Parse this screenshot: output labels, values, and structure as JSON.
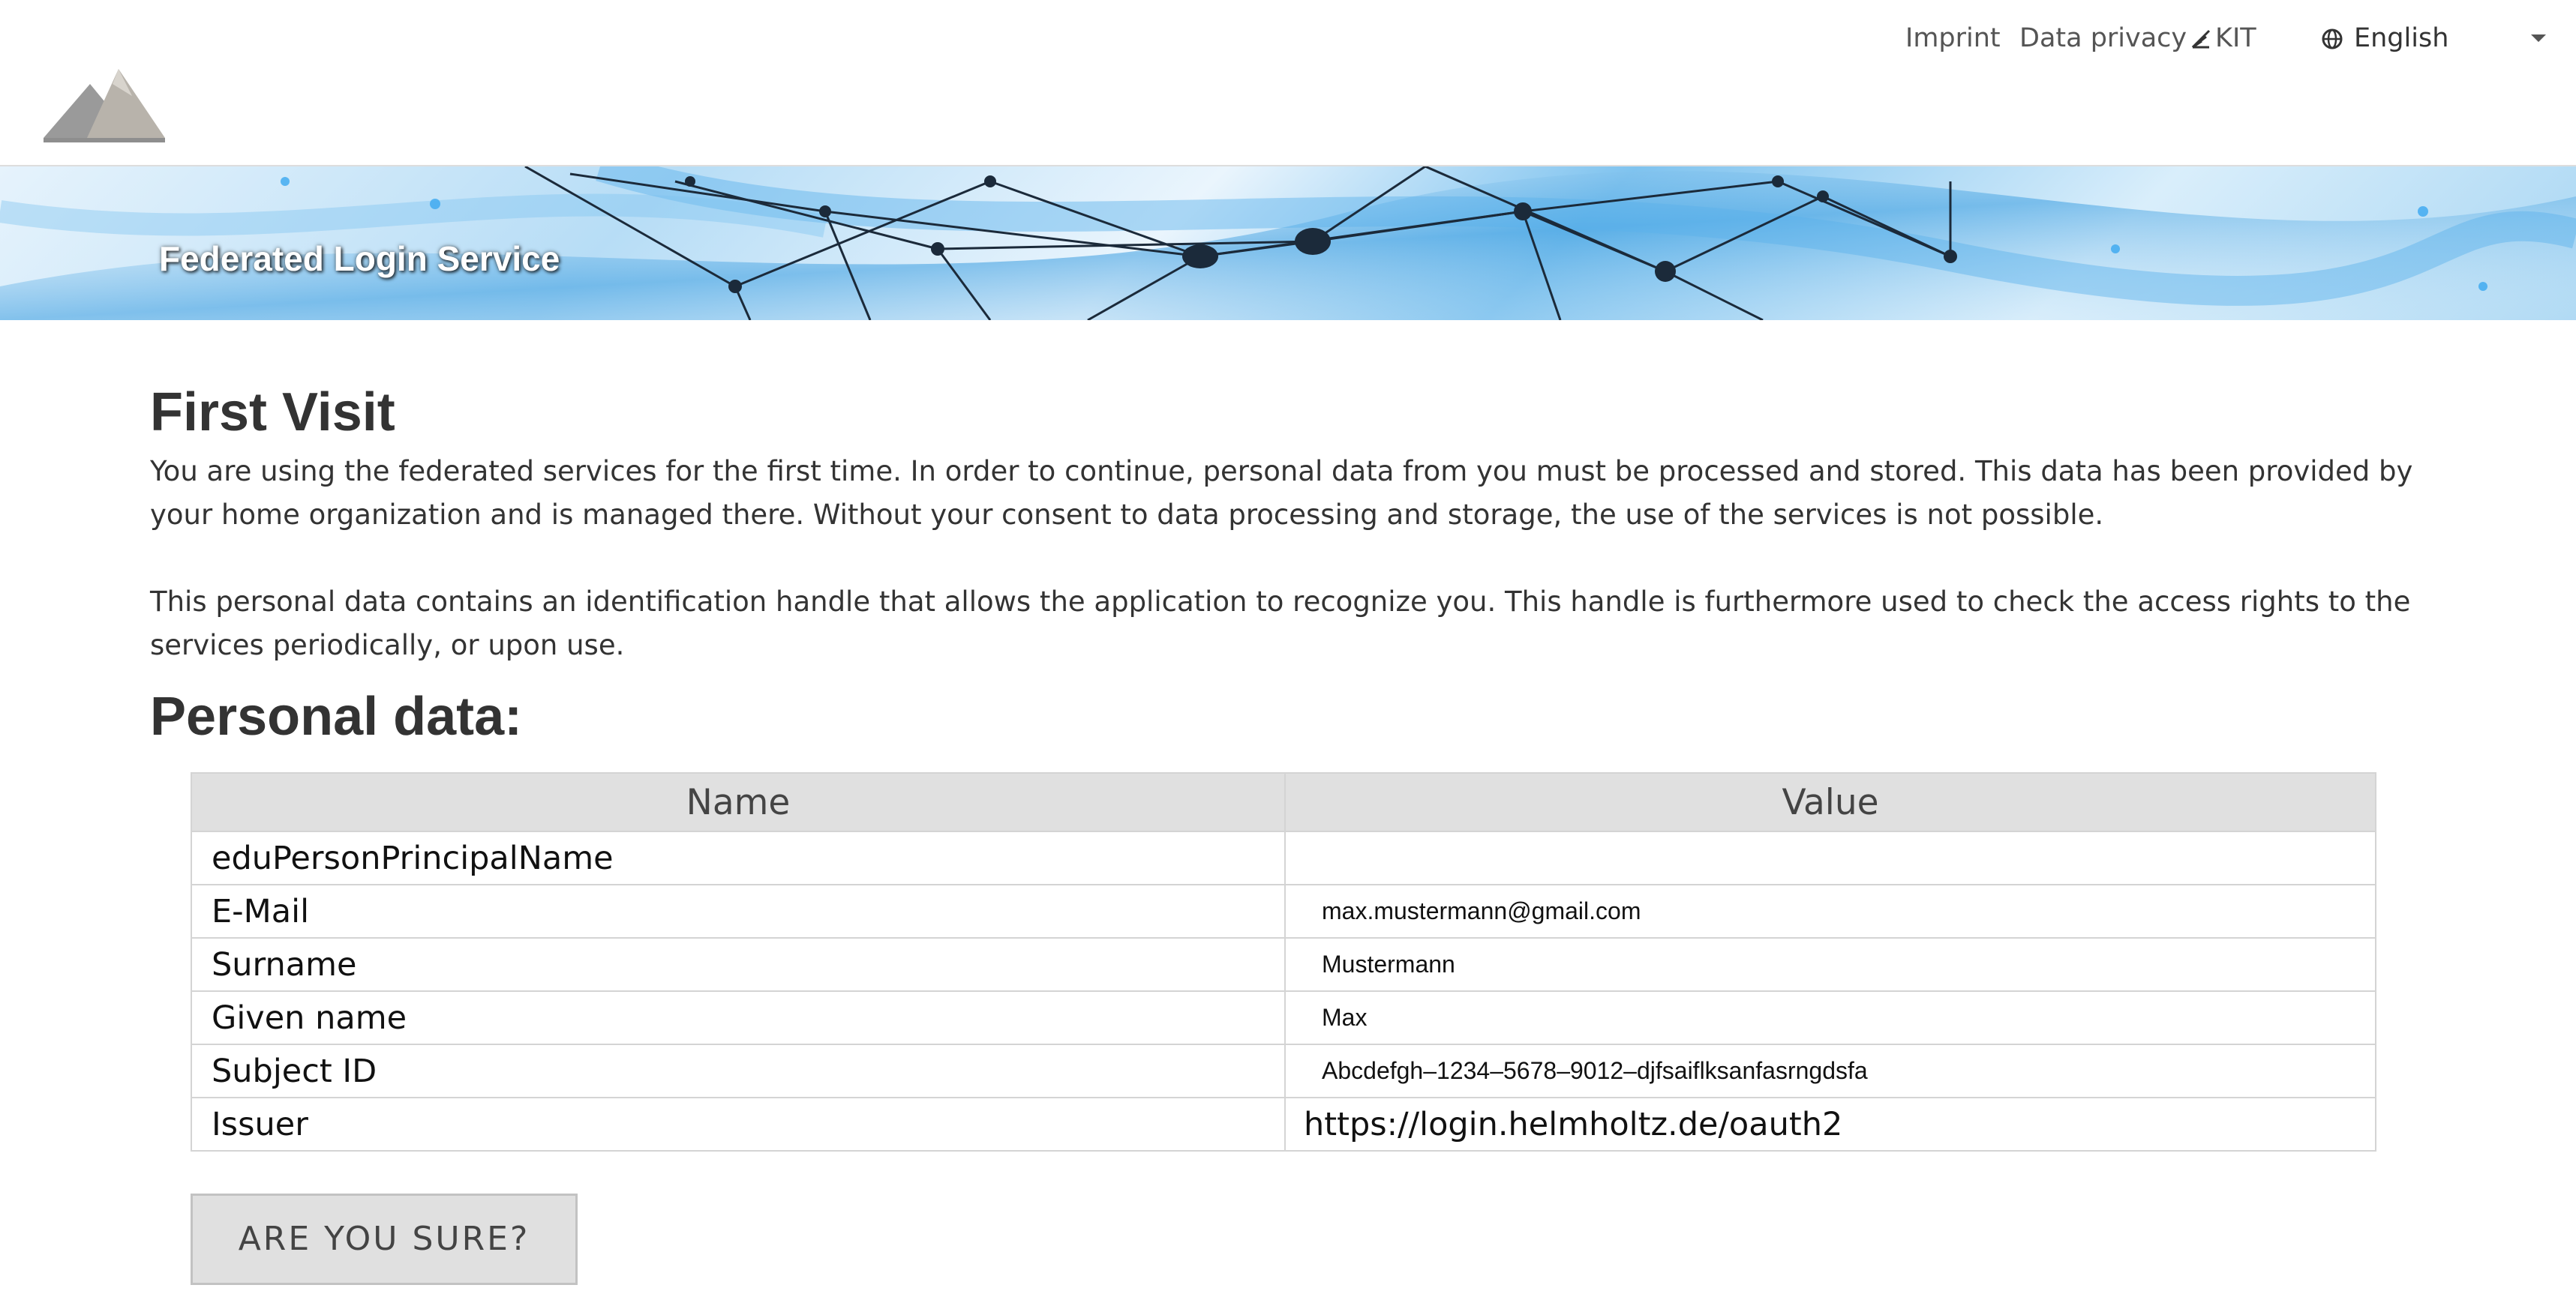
{
  "header": {
    "nav_links": {
      "imprint": "Imprint",
      "data_privacy": "Data privacy",
      "kit": "KIT"
    },
    "language": {
      "selected": "English"
    },
    "icons": {
      "logo": "mountain-logo",
      "kit": "kit-logo-icon",
      "language": "globe-icon",
      "dropdown": "caret-down-icon"
    }
  },
  "banner": {
    "title": "Federated Login Service"
  },
  "main": {
    "first_visit_heading": "First Visit",
    "intro_paragraph": "You are using the federated services for the first time. In order to continue, personal data from you must be processed and stored. This data has been provided by your home organization and is managed there. Without your consent to data processing and storage, the use of the services is not possible.",
    "handle_paragraph": "This personal data contains an identification handle that allows the application to recognize you. This handle is furthermore used to check the access rights to the services periodically, or upon use.",
    "personal_data_heading": "Personal data:"
  },
  "table": {
    "headers": [
      "Name",
      "Value"
    ],
    "rows": [
      {
        "name": "eduPersonPrincipalName",
        "value": ""
      },
      {
        "name": "E-Mail",
        "value": "max.mustermann@gmail.com"
      },
      {
        "name": "Surname",
        "value": "Mustermann"
      },
      {
        "name": "Given name",
        "value": "Max"
      },
      {
        "name": "Subject ID",
        "value": "Abcdefgh–1234–5678–9012–djfsaiflksanfasrngdsfa"
      },
      {
        "name": "Issuer",
        "value": "https://login.helmholtz.de/oauth2"
      }
    ]
  },
  "actions": {
    "confirm_label": "ARE YOU SURE?"
  },
  "colors": {
    "text": "#333333",
    "table_header_bg": "#e0e0e0",
    "table_border": "#d4d4d4",
    "button_bg": "#e0e0e0",
    "banner_accent": "#3a9de0"
  }
}
